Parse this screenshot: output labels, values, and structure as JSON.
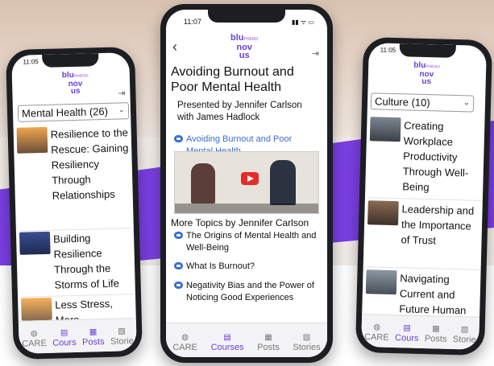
{
  "colors": {
    "accent": "#6b3fd9",
    "link": "#3b6ed3",
    "purple_band": "#7b3fe4"
  },
  "logo": {
    "text_line1": "blu",
    "text_line2": "nov",
    "text_line3": "us",
    "tag": "PHENO"
  },
  "left_phone": {
    "time": "11:05",
    "category_select": "Mental Health (26)",
    "items": [
      {
        "title": "Resilience to the Rescue: Gaining Resiliency Through Relationships"
      },
      {
        "title": "Building Resilience Through the Storms of Life"
      },
      {
        "title": "Less Stress, More"
      }
    ],
    "tabs": [
      "CARE",
      "Cours",
      "Posts",
      "Storie"
    ]
  },
  "center_phone": {
    "time": "11:07",
    "title": "Avoiding Burnout and Poor Mental Health",
    "presenter": "Presented by Jennifer Carlson with James Hadlock",
    "video_link": "Avoiding Burnout and Poor Mental Health",
    "more_topics_heading": "More Topics by Jennifer Carlson",
    "topics": [
      "The Origins of Mental Health and Well-Being",
      "What Is Burnout?",
      "Negativity Bias and the Power of Noticing Good Experiences"
    ],
    "tabs": [
      "CARE",
      "Courses",
      "Posts",
      "Stories"
    ],
    "active_tab": "Courses"
  },
  "right_phone": {
    "time": "11:05",
    "category_select": "Culture (10)",
    "items": [
      {
        "title": "Creating Workplace Productivity Through Well-Being"
      },
      {
        "title": "Leadership and the Importance of Trust"
      },
      {
        "title": "Navigating Current and Future Human"
      }
    ],
    "tabs": [
      "CARE",
      "Cours",
      "Posts",
      "Storie"
    ]
  }
}
